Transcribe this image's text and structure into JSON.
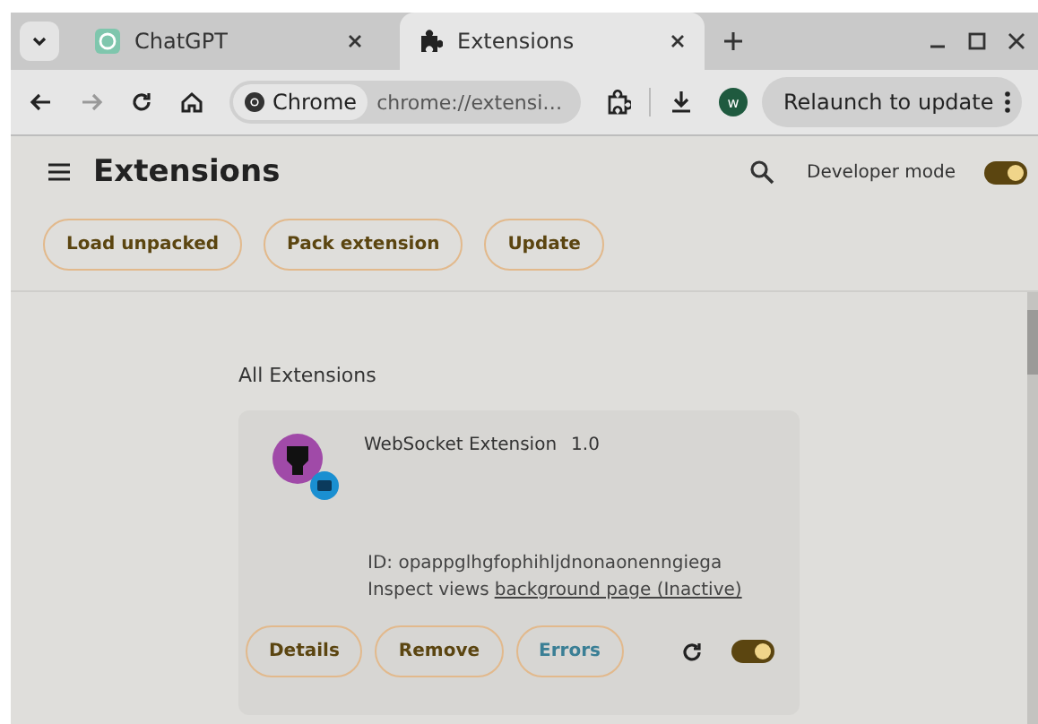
{
  "tabs": [
    {
      "title": "ChatGPT",
      "kind": "site",
      "selected": false
    },
    {
      "title": "Extensions",
      "kind": "settings",
      "selected": true
    }
  ],
  "omnibox": {
    "chip": "Chrome",
    "url": "chrome://extensi…"
  },
  "profile": {
    "initial": "w"
  },
  "relaunch": {
    "label": "Relaunch to update"
  },
  "header": {
    "title": "Extensions",
    "developer_mode": {
      "label": "Developer mode",
      "on": true
    }
  },
  "actions": [
    "Load unpacked",
    "Pack extension",
    "Update"
  ],
  "section_title": "All Extensions",
  "extensions": [
    {
      "name": "WebSocket Extension",
      "version": "1.0",
      "id": "ID: opappglhgfophihljdnonaonenngiega",
      "inspect_label": "Inspect views",
      "inspect_link": "background page (Inactive)",
      "buttons": [
        {
          "label": "Details",
          "kind": "normal"
        },
        {
          "label": "Remove",
          "kind": "normal"
        },
        {
          "label": "Errors",
          "kind": "error"
        }
      ],
      "enabled": true
    }
  ]
}
